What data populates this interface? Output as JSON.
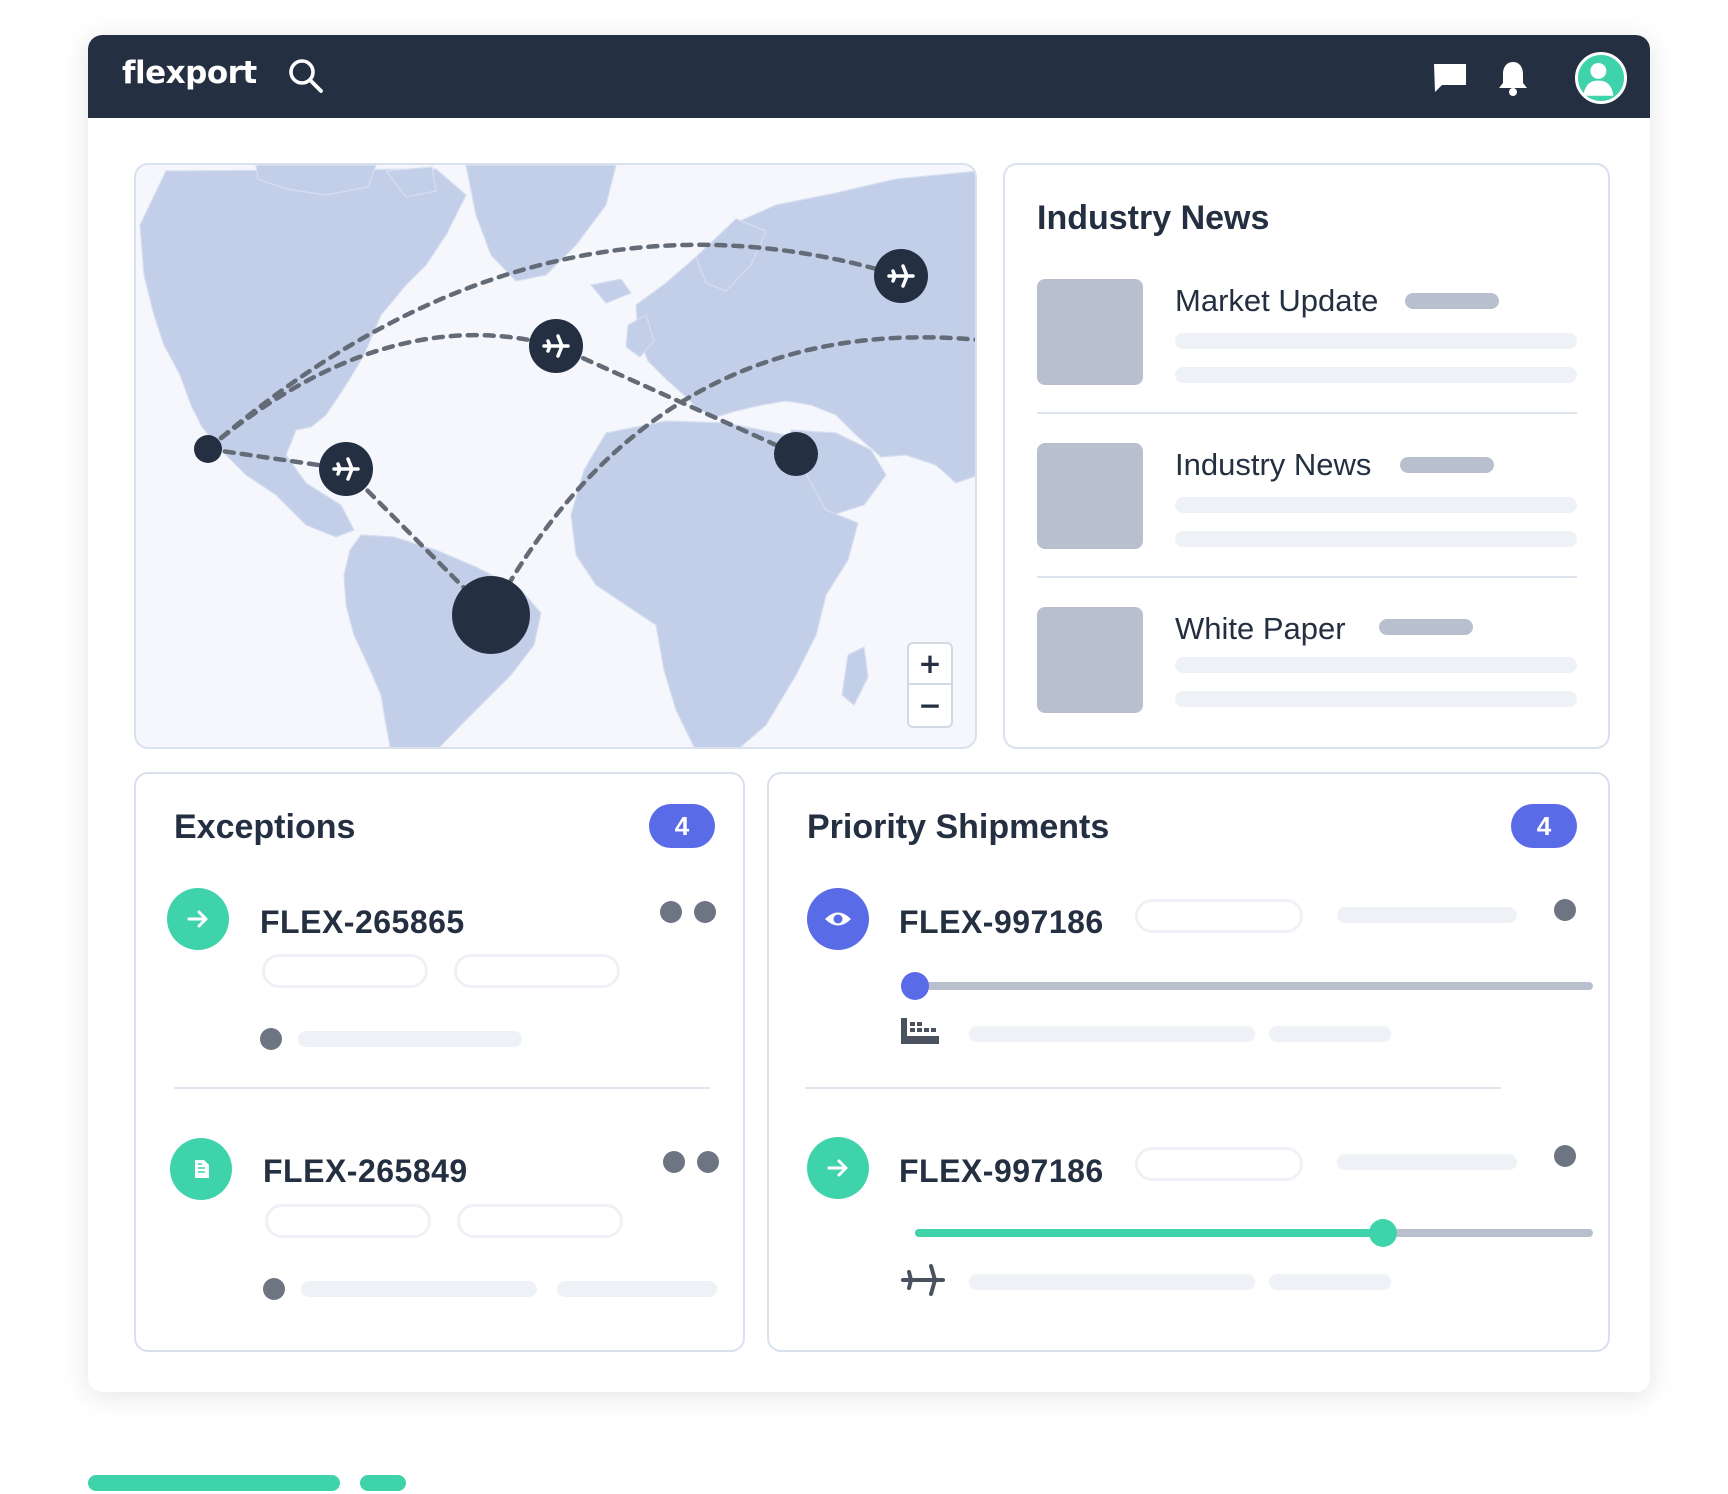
{
  "header": {
    "logo": "flexport",
    "icons": [
      "search-icon",
      "chat-icon",
      "bell-icon",
      "avatar"
    ]
  },
  "map": {
    "zoom_in": "+",
    "zoom_out": "−"
  },
  "news": {
    "title": "Industry News",
    "items": [
      {
        "label": "Market Update"
      },
      {
        "label": "Industry News"
      },
      {
        "label": "White Paper"
      }
    ]
  },
  "exceptions": {
    "title": "Exceptions",
    "count": "4",
    "items": [
      {
        "id": "FLEX-265865",
        "icon": "arrow-right-icon"
      },
      {
        "id": "FLEX-265849",
        "icon": "document-icon"
      }
    ]
  },
  "priority": {
    "title": "Priority Shipments",
    "count": "4",
    "items": [
      {
        "id": "FLEX-997186",
        "icon": "eye-icon",
        "mode": "ship-icon",
        "progress": 0.0
      },
      {
        "id": "FLEX-997186",
        "icon": "arrow-right-icon",
        "mode": "plane-icon",
        "progress": 0.69
      }
    ]
  },
  "colors": {
    "navy": "#243041",
    "teal": "#3fd3ac",
    "blue": "#5a6be8",
    "gray": "#b9c0cd",
    "land": "#c3cfe8",
    "ocean": "#f5f7fc"
  }
}
